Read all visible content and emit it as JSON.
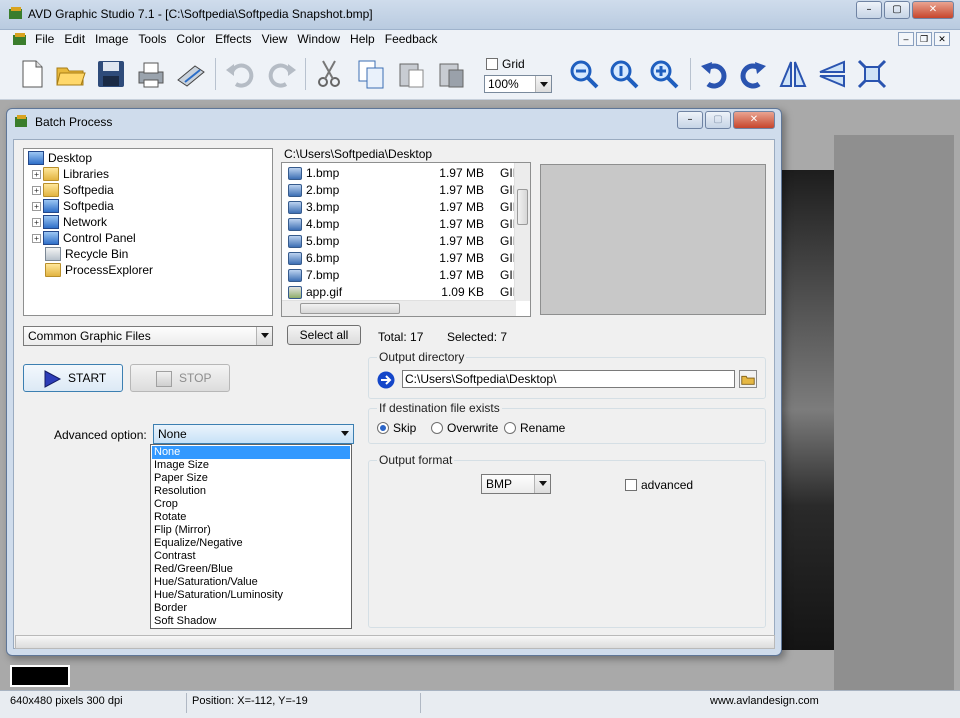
{
  "window": {
    "title": "AVD Graphic Studio 7.1 - [C:\\Softpedia\\Softpedia Snapshot.bmp]",
    "controls": {
      "minimize": "–",
      "maximize": "▢",
      "close": "✕"
    }
  },
  "menubar": {
    "items": [
      "File",
      "Edit",
      "Image",
      "Tools",
      "Color",
      "Effects",
      "View",
      "Window",
      "Help",
      "Feedback"
    ]
  },
  "toolbar": {
    "grid_label": "Grid",
    "grid_checked": false,
    "zoom_value": "100%",
    "icons": [
      "new-icon",
      "open-icon",
      "save-icon",
      "print-icon",
      "scan-icon",
      "undo-icon",
      "redo-icon",
      "cut-icon",
      "copy-icon",
      "paste-icon",
      "paste-special-icon",
      "zoom-out-icon",
      "zoom-actual-icon",
      "zoom-in-icon",
      "rotate-left-icon",
      "rotate-right-icon",
      "flip-horizontal-icon",
      "flip-vertical-icon",
      "fit-screen-icon"
    ]
  },
  "dialog": {
    "title": "Batch Process",
    "folder_tree": [
      {
        "label": "Desktop",
        "icon": "desktop-icon",
        "expandable": false,
        "level": 0
      },
      {
        "label": "Libraries",
        "icon": "libraries-icon",
        "expandable": true,
        "level": 1
      },
      {
        "label": "Softpedia",
        "icon": "folder-icon",
        "expandable": true,
        "level": 1
      },
      {
        "label": "Softpedia",
        "icon": "computer-icon",
        "expandable": true,
        "level": 1
      },
      {
        "label": "Network",
        "icon": "network-icon",
        "expandable": true,
        "level": 1
      },
      {
        "label": "Control Panel",
        "icon": "control-panel-icon",
        "expandable": true,
        "level": 1
      },
      {
        "label": "Recycle Bin",
        "icon": "recycle-bin-icon",
        "expandable": false,
        "level": 1
      },
      {
        "label": "ProcessExplorer",
        "icon": "folder-icon",
        "expandable": false,
        "level": 1
      }
    ],
    "filter_value": "Common Graphic Files",
    "current_path": "C:\\Users\\Softpedia\\Desktop",
    "files": [
      {
        "name": "1.bmp",
        "size": "1.97 MB",
        "type": "GII"
      },
      {
        "name": "2.bmp",
        "size": "1.97 MB",
        "type": "GII"
      },
      {
        "name": "3.bmp",
        "size": "1.97 MB",
        "type": "GII"
      },
      {
        "name": "4.bmp",
        "size": "1.97 MB",
        "type": "GII"
      },
      {
        "name": "5.bmp",
        "size": "1.97 MB",
        "type": "GII"
      },
      {
        "name": "6.bmp",
        "size": "1.97 MB",
        "type": "GII"
      },
      {
        "name": "7.bmp",
        "size": "1.97 MB",
        "type": "GII"
      },
      {
        "name": "app.gif",
        "size": "1.09 KB",
        "type": "GII"
      }
    ],
    "select_all_label": "Select all",
    "total_label": "Total: 17",
    "selected_label": "Selected: 7",
    "start_label": "START",
    "stop_label": "STOP",
    "output_directory": {
      "title": "Output directory",
      "value": "C:\\Users\\Softpedia\\Desktop\\"
    },
    "destination_exists": {
      "title": "If destination file exists",
      "options": [
        "Skip",
        "Overwrite",
        "Rename"
      ],
      "selected": "Skip"
    },
    "output_format": {
      "title": "Output format",
      "value": "BMP",
      "advanced_label": "advanced",
      "advanced_checked": false
    },
    "advanced_option": {
      "label": "Advanced option:",
      "value": "None",
      "options": [
        "None",
        "Image Size",
        "Paper Size",
        "Resolution",
        "Crop",
        "Rotate",
        "Flip (Mirror)",
        "Equalize/Negative",
        "Contrast",
        "Red/Green/Blue",
        "Hue/Saturation/Value",
        "Hue/Saturation/Luminosity",
        "Border",
        "Soft Shadow"
      ],
      "highlighted": "None"
    }
  },
  "statusbar": {
    "dimensions": "640x480 pixels  300 dpi",
    "position": "Position: X=-112, Y=-19",
    "website": "www.avlandesign.com"
  }
}
